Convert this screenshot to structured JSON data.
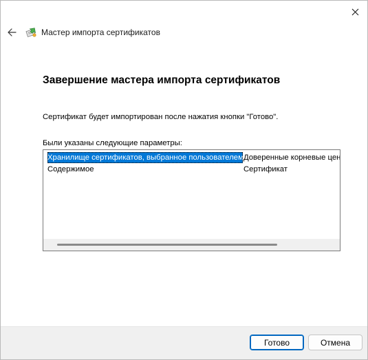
{
  "window": {
    "title": "Мастер импорта сертификатов"
  },
  "icons": {
    "back": "back-arrow-icon",
    "app": "certificate-wizard-icon",
    "close": "close-icon"
  },
  "main": {
    "heading": "Завершение мастера импорта сертификатов",
    "info_text": "Сертификат будет импортирован после нажатия кнопки \"Готово\".",
    "params_label": "Были указаны следующие параметры:"
  },
  "params_list": {
    "rows": [
      {
        "name": "Хранилище сертификатов, выбранное пользователем",
        "value": "Доверенные корневые центры сертификации",
        "selected": true
      },
      {
        "name": "Содержимое",
        "value": "Сертификат",
        "selected": false
      }
    ]
  },
  "footer": {
    "finish_label": "Готово",
    "cancel_label": "Отмена"
  },
  "colors": {
    "selection": "#0078d7",
    "primary_border": "#0067c0",
    "footer_bg": "#f0f0f0"
  }
}
